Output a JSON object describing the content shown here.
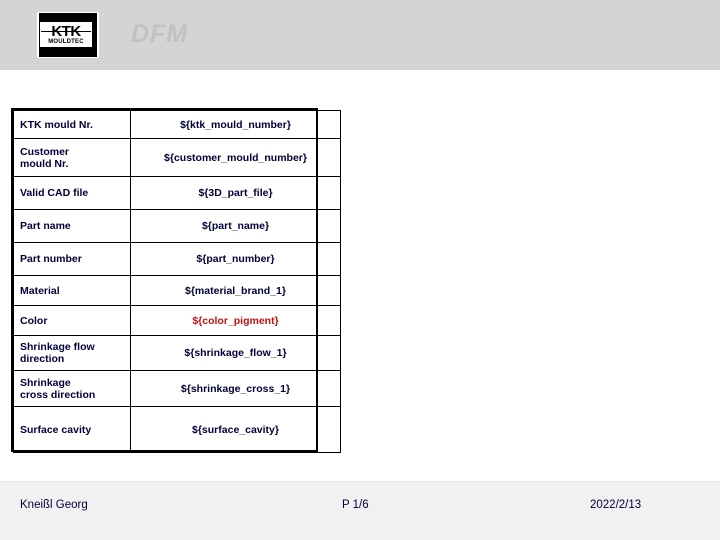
{
  "header": {
    "title": "DFM",
    "logo": {
      "brand": "KTK",
      "sub": "MOULDTEC"
    }
  },
  "colors": {
    "header_band": "#d4d4d4",
    "header_title": "#c2c2c2",
    "table_text": "#00003a",
    "accent_red": "#c10f0f",
    "footer_bg": "#f1f1f1"
  },
  "table": {
    "rows": [
      {
        "label": "KTK mould Nr.",
        "value": "${ktk_mould_number}"
      },
      {
        "label": "Customer\nmould Nr.",
        "value": "${customer_mould_number}"
      },
      {
        "label": "Valid CAD file",
        "value": "${3D_part_file}"
      },
      {
        "label": "Part name",
        "value": "${part_name}"
      },
      {
        "label": "Part number",
        "value": "${part_number}"
      },
      {
        "label": "Material",
        "value": "${material_brand_1}"
      },
      {
        "label": "Color",
        "value": "${color_pigment}"
      },
      {
        "label": "Shrinkage flow\ndirection",
        "value": "${shrinkage_flow_1}"
      },
      {
        "label": "Shrinkage\ncross direction",
        "value": "${shrinkage_cross_1}"
      },
      {
        "label": "Surface cavity",
        "value": "${surface_cavity}"
      }
    ]
  },
  "footer": {
    "author": "Kneißl Georg",
    "page": "P  1/6",
    "date": "2022/2/13"
  }
}
